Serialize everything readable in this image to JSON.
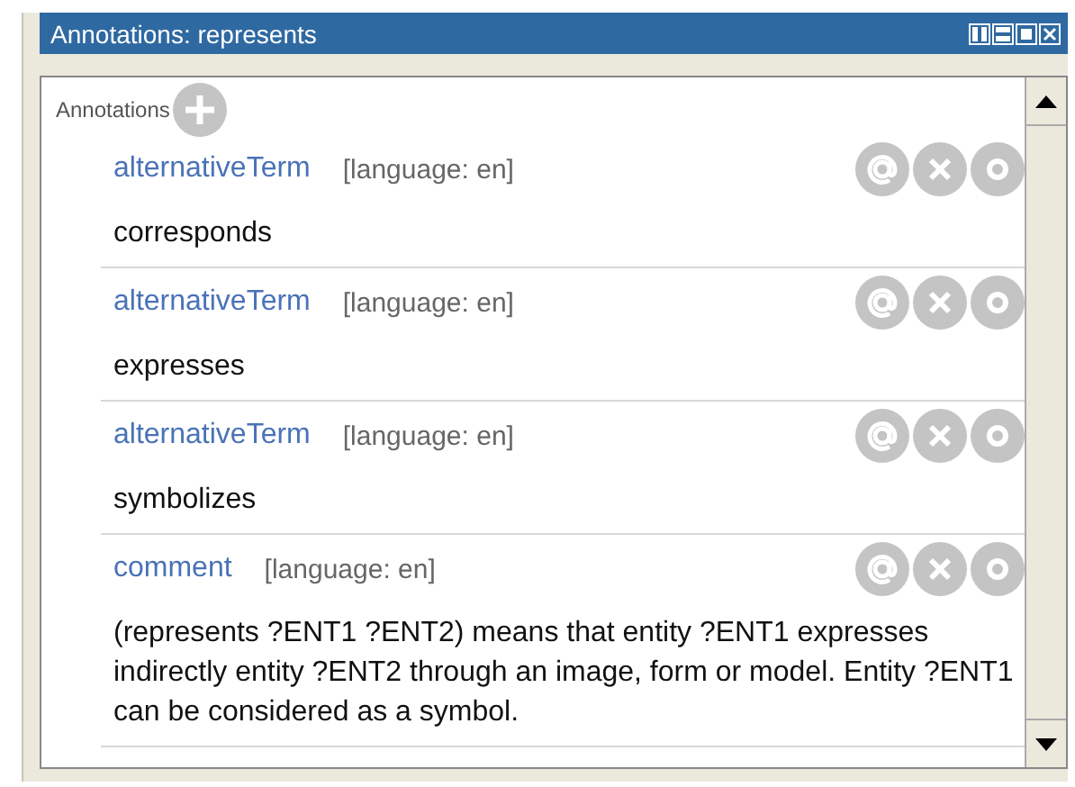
{
  "window": {
    "title": "Annotations: represents"
  },
  "section": {
    "label": "Annotations"
  },
  "annotations": [
    {
      "property": "alternativeTerm",
      "language": "[language: en]",
      "value": "corresponds"
    },
    {
      "property": "alternativeTerm",
      "language": "[language: en]",
      "value": "expresses"
    },
    {
      "property": "alternativeTerm",
      "language": "[language: en]",
      "value": "symbolizes"
    },
    {
      "property": "comment",
      "language": "[language: en]",
      "value": "(represents ?ENT1 ?ENT2) means that entity ?ENT1 expresses indirectly entity ?ENT2 through an image, form or model. Entity ?ENT1 can be considered as a symbol."
    }
  ]
}
